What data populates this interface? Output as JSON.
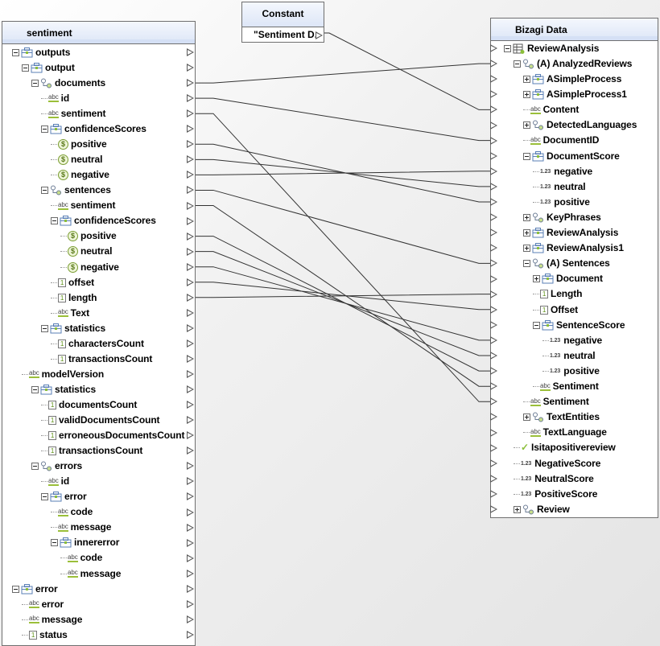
{
  "source_panel": {
    "title": "sentiment",
    "rows": [
      {
        "label": "outputs",
        "icon": "object-icon",
        "expand": "minus",
        "level": 0
      },
      {
        "label": "output",
        "icon": "object-icon",
        "expand": "minus",
        "level": 1
      },
      {
        "label": "documents",
        "icon": "collection-icon",
        "expand": "minus",
        "level": 2
      },
      {
        "label": "id",
        "icon": "text-icon",
        "level": 3
      },
      {
        "label": "sentiment",
        "icon": "text-icon",
        "level": 3
      },
      {
        "label": "confidenceScores",
        "icon": "object-icon",
        "expand": "minus",
        "level": 3
      },
      {
        "label": "positive",
        "icon": "currency-icon",
        "level": 4
      },
      {
        "label": "neutral",
        "icon": "currency-icon",
        "level": 4
      },
      {
        "label": "negative",
        "icon": "currency-icon",
        "level": 4
      },
      {
        "label": "sentences",
        "icon": "collection-icon",
        "expand": "minus",
        "level": 3
      },
      {
        "label": "sentiment",
        "icon": "text-icon",
        "level": 4
      },
      {
        "label": "confidenceScores",
        "icon": "object-icon",
        "expand": "minus",
        "level": 4
      },
      {
        "label": "positive",
        "icon": "currency-icon",
        "level": 5
      },
      {
        "label": "neutral",
        "icon": "currency-icon",
        "level": 5
      },
      {
        "label": "negative",
        "icon": "currency-icon",
        "level": 5
      },
      {
        "label": "offset",
        "icon": "integer-icon",
        "level": 4
      },
      {
        "label": "length",
        "icon": "integer-icon",
        "level": 4
      },
      {
        "label": "Text",
        "icon": "text-icon",
        "level": 4
      },
      {
        "label": "statistics",
        "icon": "object-icon",
        "expand": "minus",
        "level": 3
      },
      {
        "label": "charactersCount",
        "icon": "integer-icon",
        "level": 4
      },
      {
        "label": "transactionsCount",
        "icon": "integer-icon",
        "level": 4
      },
      {
        "label": "modelVersion",
        "icon": "text-icon",
        "level": 1
      },
      {
        "label": "statistics",
        "icon": "object-icon",
        "expand": "minus",
        "level": 2
      },
      {
        "label": "documentsCount",
        "icon": "integer-icon",
        "level": 3
      },
      {
        "label": "validDocumentsCount",
        "icon": "integer-icon",
        "level": 3
      },
      {
        "label": "erroneousDocumentsCount",
        "icon": "integer-icon",
        "level": 3
      },
      {
        "label": "transactionsCount",
        "icon": "integer-icon",
        "level": 3
      },
      {
        "label": "errors",
        "icon": "collection-icon",
        "expand": "minus",
        "level": 2
      },
      {
        "label": "id",
        "icon": "text-icon",
        "level": 3
      },
      {
        "label": "error",
        "icon": "object-icon",
        "expand": "minus",
        "level": 3
      },
      {
        "label": "code",
        "icon": "text-icon",
        "level": 4
      },
      {
        "label": "message",
        "icon": "text-icon",
        "level": 4
      },
      {
        "label": "innererror",
        "icon": "object-icon",
        "expand": "minus",
        "level": 4
      },
      {
        "label": "code",
        "icon": "text-icon",
        "level": 5
      },
      {
        "label": "message",
        "icon": "text-icon",
        "level": 5
      },
      {
        "label": "error",
        "icon": "object-icon",
        "expand": "minus",
        "level": 0
      },
      {
        "label": "error",
        "icon": "text-icon",
        "level": 1
      },
      {
        "label": "message",
        "icon": "text-icon",
        "level": 1
      },
      {
        "label": "status",
        "icon": "integer-icon",
        "level": 1
      }
    ]
  },
  "constant_panel": {
    "title": "Constant",
    "value": "\"Sentiment D."
  },
  "target_panel": {
    "title": "Bizagi Data",
    "rows": [
      {
        "label": "ReviewAnalysis",
        "icon": "entity-icon",
        "expand": "minus",
        "level": 0
      },
      {
        "label": "(A) AnalyzedReviews",
        "icon": "collection-icon",
        "expand": "minus",
        "level": 1
      },
      {
        "label": "ASimpleProcess",
        "icon": "object-icon",
        "expand": "plus",
        "level": 2
      },
      {
        "label": "ASimpleProcess1",
        "icon": "object-icon",
        "expand": "plus",
        "level": 2
      },
      {
        "label": "Content",
        "icon": "text-icon",
        "level": 2
      },
      {
        "label": "DetectedLanguages",
        "icon": "collection-icon",
        "expand": "plus",
        "level": 2
      },
      {
        "label": "DocumentID",
        "icon": "text-icon",
        "level": 2
      },
      {
        "label": "DocumentScore",
        "icon": "object-icon",
        "expand": "minus",
        "level": 2
      },
      {
        "label": "negative",
        "icon": "decimal-icon",
        "level": 3
      },
      {
        "label": "neutral",
        "icon": "decimal-icon",
        "level": 3
      },
      {
        "label": "positive",
        "icon": "decimal-icon",
        "level": 3
      },
      {
        "label": "KeyPhrases",
        "icon": "collection-icon",
        "expand": "plus",
        "level": 2
      },
      {
        "label": "ReviewAnalysis",
        "icon": "object-icon",
        "expand": "plus",
        "level": 2
      },
      {
        "label": "ReviewAnalysis1",
        "icon": "object-icon",
        "expand": "plus",
        "level": 2
      },
      {
        "label": "(A) Sentences",
        "icon": "collection-icon",
        "expand": "minus",
        "level": 2
      },
      {
        "label": "Document",
        "icon": "object-icon",
        "expand": "plus",
        "level": 3
      },
      {
        "label": "Length",
        "icon": "integer-icon",
        "level": 3
      },
      {
        "label": "Offset",
        "icon": "integer-icon",
        "level": 3
      },
      {
        "label": "SentenceScore",
        "icon": "object-icon",
        "expand": "minus",
        "level": 3
      },
      {
        "label": "negative",
        "icon": "decimal-icon",
        "level": 4
      },
      {
        "label": "neutral",
        "icon": "decimal-icon",
        "level": 4
      },
      {
        "label": "positive",
        "icon": "decimal-icon",
        "level": 4
      },
      {
        "label": "Sentiment",
        "icon": "text-icon",
        "level": 3
      },
      {
        "label": "Sentiment",
        "icon": "text-icon",
        "level": 2
      },
      {
        "label": "TextEntities",
        "icon": "collection-icon",
        "expand": "plus",
        "level": 2
      },
      {
        "label": "TextLanguage",
        "icon": "text-icon",
        "level": 2
      },
      {
        "label": "Isitapositivereview",
        "icon": "boolean-icon",
        "level": 1
      },
      {
        "label": "NegativeScore",
        "icon": "decimal-icon",
        "level": 1
      },
      {
        "label": "NeutralScore",
        "icon": "decimal-icon",
        "level": 1
      },
      {
        "label": "PositiveScore",
        "icon": "decimal-icon",
        "level": 1
      },
      {
        "label": "Review",
        "icon": "collection-icon",
        "expand": "plus",
        "level": 1
      }
    ]
  },
  "mappings": [
    {
      "from": "source:2",
      "to": "target:1"
    },
    {
      "from": "source:3",
      "to": "target:6"
    },
    {
      "from": "source:4",
      "to": "target:23"
    },
    {
      "from": "source:6",
      "to": "target:10"
    },
    {
      "from": "source:7",
      "to": "target:9"
    },
    {
      "from": "source:8",
      "to": "target:8"
    },
    {
      "from": "source:9",
      "to": "target:14"
    },
    {
      "from": "source:10",
      "to": "target:22"
    },
    {
      "from": "source:12",
      "to": "target:21"
    },
    {
      "from": "source:13",
      "to": "target:20"
    },
    {
      "from": "source:14",
      "to": "target:19"
    },
    {
      "from": "source:15",
      "to": "target:17"
    },
    {
      "from": "source:16",
      "to": "target:16"
    },
    {
      "from": "constant:0",
      "to": "target:4"
    }
  ]
}
